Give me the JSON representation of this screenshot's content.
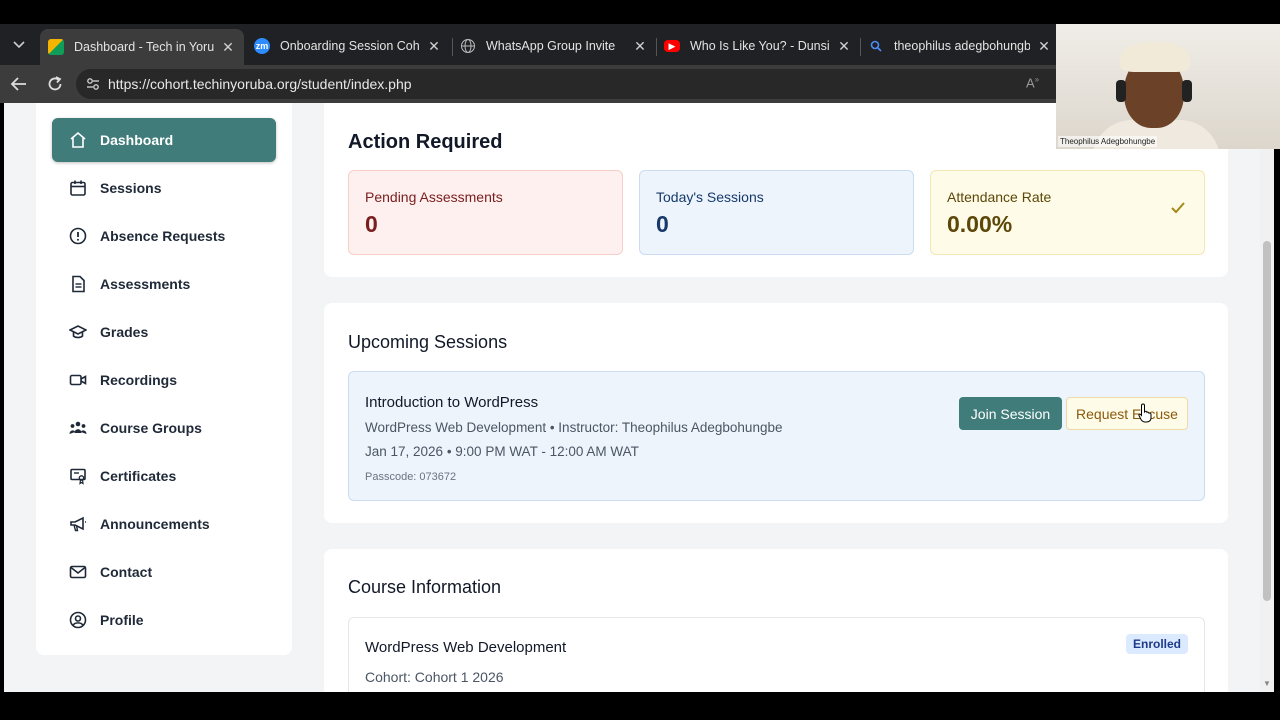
{
  "browser": {
    "tabs": [
      {
        "title": "Dashboard - Tech in Yoruba",
        "icon": "google-sites-icon",
        "active": true
      },
      {
        "title": "Onboarding Session Cohort",
        "icon": "zoom-icon",
        "active": false
      },
      {
        "title": "WhatsApp Group Invite",
        "icon": "globe-icon",
        "active": false
      },
      {
        "title": "Who Is Like You? - Dunsin O",
        "icon": "youtube-icon",
        "active": false
      },
      {
        "title": "theophilus adegbohungbe",
        "icon": "search-icon",
        "active": false
      }
    ],
    "url": "https://cohort.techinyoruba.org/student/index.php",
    "zoom_favicon_text": "zm"
  },
  "sidebar": {
    "items": [
      {
        "label": "Dashboard",
        "icon": "home-icon",
        "active": true
      },
      {
        "label": "Sessions",
        "icon": "calendar-icon",
        "active": false
      },
      {
        "label": "Absence Requests",
        "icon": "alert-circle-icon",
        "active": false
      },
      {
        "label": "Assessments",
        "icon": "document-icon",
        "active": false
      },
      {
        "label": "Grades",
        "icon": "graduation-cap-icon",
        "active": false
      },
      {
        "label": "Recordings",
        "icon": "video-icon",
        "active": false
      },
      {
        "label": "Course Groups",
        "icon": "users-icon",
        "active": false
      },
      {
        "label": "Certificates",
        "icon": "certificate-icon",
        "active": false
      },
      {
        "label": "Announcements",
        "icon": "megaphone-icon",
        "active": false
      },
      {
        "label": "Contact",
        "icon": "mail-icon",
        "active": false
      },
      {
        "label": "Profile",
        "icon": "user-circle-icon",
        "active": false
      }
    ]
  },
  "action_required": {
    "title": "Action Required",
    "stats": [
      {
        "label": "Pending Assessments",
        "value": "0",
        "color": "#fdf0ee"
      },
      {
        "label": "Today's Sessions",
        "value": "0",
        "color": "#edf4fc"
      },
      {
        "label": "Attendance Rate",
        "value": "0.00%",
        "color": "#fefbe8",
        "icon": "check-icon"
      }
    ]
  },
  "upcoming": {
    "title": "Upcoming Sessions",
    "session": {
      "title": "Introduction to WordPress",
      "subtitle": "WordPress Web Development • Instructor: Theophilus Adegbohungbe",
      "when": "Jan 17, 2026 • 9:00 PM WAT - 12:00 AM WAT",
      "passcode": "Passcode: 073672",
      "join_label": "Join Session",
      "excuse_label": "Request Excuse"
    }
  },
  "course_info": {
    "title": "Course Information",
    "course_name": "WordPress Web Development",
    "cohort": "Cohort: Cohort 1 2026",
    "badge": "Enrolled"
  },
  "webcam": {
    "name": "Theophilus Adegbohungbe"
  },
  "colors": {
    "accent": "#3f7c7a",
    "page_bg": "#f3f4f6"
  }
}
